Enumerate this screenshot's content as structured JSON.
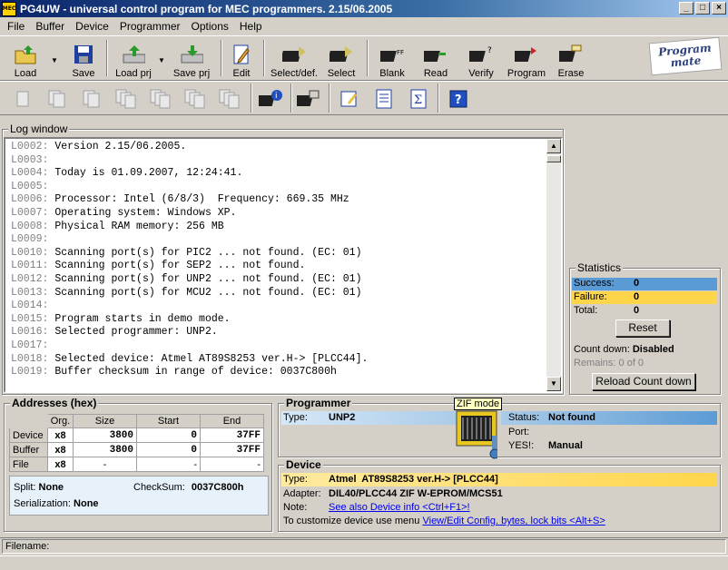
{
  "window": {
    "title": "PG4UW - universal control program for MEC programmers. 2.15/06.2005",
    "app_icon_text": "MEC",
    "controls": [
      "_",
      "□",
      "×"
    ]
  },
  "menu": [
    "File",
    "Buffer",
    "Device",
    "Programmer",
    "Options",
    "Help"
  ],
  "toolbar": {
    "buttons": [
      "Load",
      "Save",
      "Load prj",
      "Save prj",
      "Edit",
      "Select/def.",
      "Select",
      "Blank",
      "Read",
      "Verify",
      "Program",
      "Erase"
    ],
    "logo_line1": "Program",
    "logo_line2": "mate"
  },
  "log": {
    "title": "Log window",
    "lines": [
      {
        "n": "L0002:",
        "t": "Version 2.15/06.2005."
      },
      {
        "n": "L0003:",
        "t": ""
      },
      {
        "n": "L0004:",
        "t": "Today is 01.09.2007, 12:24:41."
      },
      {
        "n": "L0005:",
        "t": ""
      },
      {
        "n": "L0006:",
        "t": "Processor: Intel (6/8/3)  Frequency: 669.35 MHz"
      },
      {
        "n": "L0007:",
        "t": "Operating system: Windows XP."
      },
      {
        "n": "L0008:",
        "t": "Physical RAM memory: 256 MB"
      },
      {
        "n": "L0009:",
        "t": ""
      },
      {
        "n": "L0010:",
        "t": "Scanning port(s) for PIC2 ... not found. (EC: 01)"
      },
      {
        "n": "L0011:",
        "t": "Scanning port(s) for SEP2 ... not found."
      },
      {
        "n": "L0012:",
        "t": "Scanning port(s) for UNP2 ... not found. (EC: 01)"
      },
      {
        "n": "L0013:",
        "t": "Scanning port(s) for MCU2 ... not found. (EC: 01)"
      },
      {
        "n": "L0014:",
        "t": ""
      },
      {
        "n": "L0015:",
        "t": "Program starts in demo mode."
      },
      {
        "n": "L0016:",
        "t": "Selected programmer: UNP2."
      },
      {
        "n": "L0017:",
        "t": ""
      },
      {
        "n": "L0018:",
        "t": "Selected device: Atmel AT89S8253 ver.H-> [PLCC44]."
      },
      {
        "n": "L0019:",
        "t": "Buffer checksum in range of device: 0037C800h"
      }
    ]
  },
  "statistics": {
    "title": "Statistics",
    "success_label": "Success:",
    "success_value": "0",
    "failure_label": "Failure:",
    "failure_value": "0",
    "total_label": "Total:",
    "total_value": "0",
    "reset_label": "Reset",
    "countdown_label": "Count down:",
    "countdown_value": "Disabled",
    "remains_label": "Remains:",
    "remains_value": "0 of 0",
    "reload_label": "Reload Count down",
    "success_color": "#5b9bd5",
    "failure_color": "#ffd54a"
  },
  "addresses": {
    "title": "Addresses (hex)",
    "columns": [
      "Org.",
      "Size",
      "Start",
      "End"
    ],
    "rows": [
      {
        "name": "Device",
        "org": "x8",
        "size": "3800",
        "start": "0",
        "end": "37FF"
      },
      {
        "name": "Buffer",
        "org": "x8",
        "size": "3800",
        "start": "0",
        "end": "37FF"
      },
      {
        "name": "File",
        "org": "x8",
        "size": "-",
        "start": "-",
        "end": "-"
      }
    ],
    "split_label": "Split:",
    "split_value": "None",
    "checksum_label": "CheckSum:",
    "checksum_value": "0037C800h",
    "serialization_label": "Serialization:",
    "serialization_value": "None"
  },
  "programmer": {
    "title": "Programmer",
    "type_label": "Type:",
    "type_value": "UNP2",
    "zif_label": "ZIF mode",
    "status_label": "Status:",
    "status_value": "Not found",
    "port_label": "Port:",
    "port_value": "",
    "yes_label": "YES!:",
    "yes_value": "Manual"
  },
  "device": {
    "title": "Device",
    "type_label": "Type:",
    "type_value": "Atmel  AT89S8253 ver.H-> [PLCC44]",
    "adapter_label": "Adapter:",
    "adapter_value": "DIL40/PLCC44 ZIF W-EPROM/MCS51",
    "note_label": "Note:",
    "note_link": "See also Device info <Ctrl+F1>!",
    "customize_text": "To customize device use menu",
    "customize_link": "View/Edit Config. bytes, lock bits <Alt+S>"
  },
  "statusbar": {
    "filename_label": "Filename:"
  }
}
